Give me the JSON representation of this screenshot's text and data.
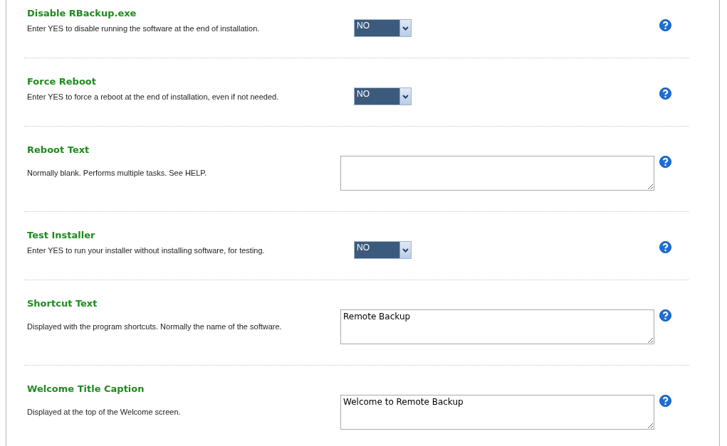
{
  "settings": [
    {
      "kind": "select",
      "title": "Disable RBackup.exe",
      "description": "Enter YES to disable running the software at the end of installation.",
      "value": "NO"
    },
    {
      "kind": "select",
      "title": "Force Reboot",
      "description": "Enter YES to force a reboot at the end of installation, even if not needed.",
      "value": "NO"
    },
    {
      "kind": "text",
      "title": "Reboot Text",
      "description": "Normally blank. Performs multiple tasks. See HELP."
    },
    {
      "kind": "select",
      "title": "Test Installer",
      "description": "Enter YES to run your installer without installing software, for testing.",
      "value": "NO"
    },
    {
      "kind": "text",
      "title": "Shortcut Text",
      "description": "Displayed with the program shortcuts. Normally the name of the software.",
      "value": "Remote Backup"
    },
    {
      "kind": "text",
      "title": "Welcome Title Caption",
      "description": "Displayed at the top of the Welcome screen.",
      "value": "Welcome to Remote Backup"
    }
  ]
}
